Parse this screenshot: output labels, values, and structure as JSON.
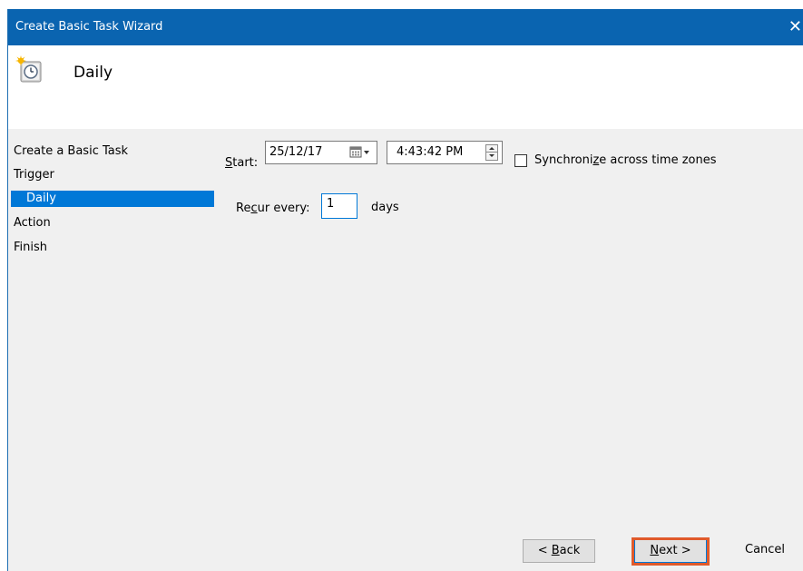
{
  "window": {
    "title": "Create Basic Task Wizard",
    "close_glyph": "✕"
  },
  "header": {
    "title": "Daily",
    "icon": "scheduled-task-clock-icon"
  },
  "nav": {
    "items": [
      {
        "label": "Create a Basic Task",
        "selected": false
      },
      {
        "label": "Trigger",
        "selected": false
      },
      {
        "label": "Daily",
        "selected": true
      },
      {
        "label": "Action",
        "selected": false
      },
      {
        "label": "Finish",
        "selected": false
      }
    ]
  },
  "form": {
    "start_label_mnemonic": "S",
    "start_label_rest": "tart:",
    "start_date": "25/12/17",
    "start_time": "4:43:42 PM",
    "sync_label_pre": "Synchroni",
    "sync_label_mnemonic": "z",
    "sync_label_post": "e across time zones",
    "sync_checked": false,
    "recur_label_pre": "Re",
    "recur_label_mnemonic": "c",
    "recur_label_post": "ur every:",
    "recur_value": "1",
    "recur_unit": "days"
  },
  "buttons": {
    "back_prefix": "< ",
    "back_mnemonic": "B",
    "back_rest": "ack",
    "next_mnemonic": "N",
    "next_rest": "ext >",
    "cancel": "Cancel"
  },
  "colors": {
    "titlebar": "#0a64b0",
    "selection": "#0078d7",
    "highlight_box": "#e05a2b"
  }
}
